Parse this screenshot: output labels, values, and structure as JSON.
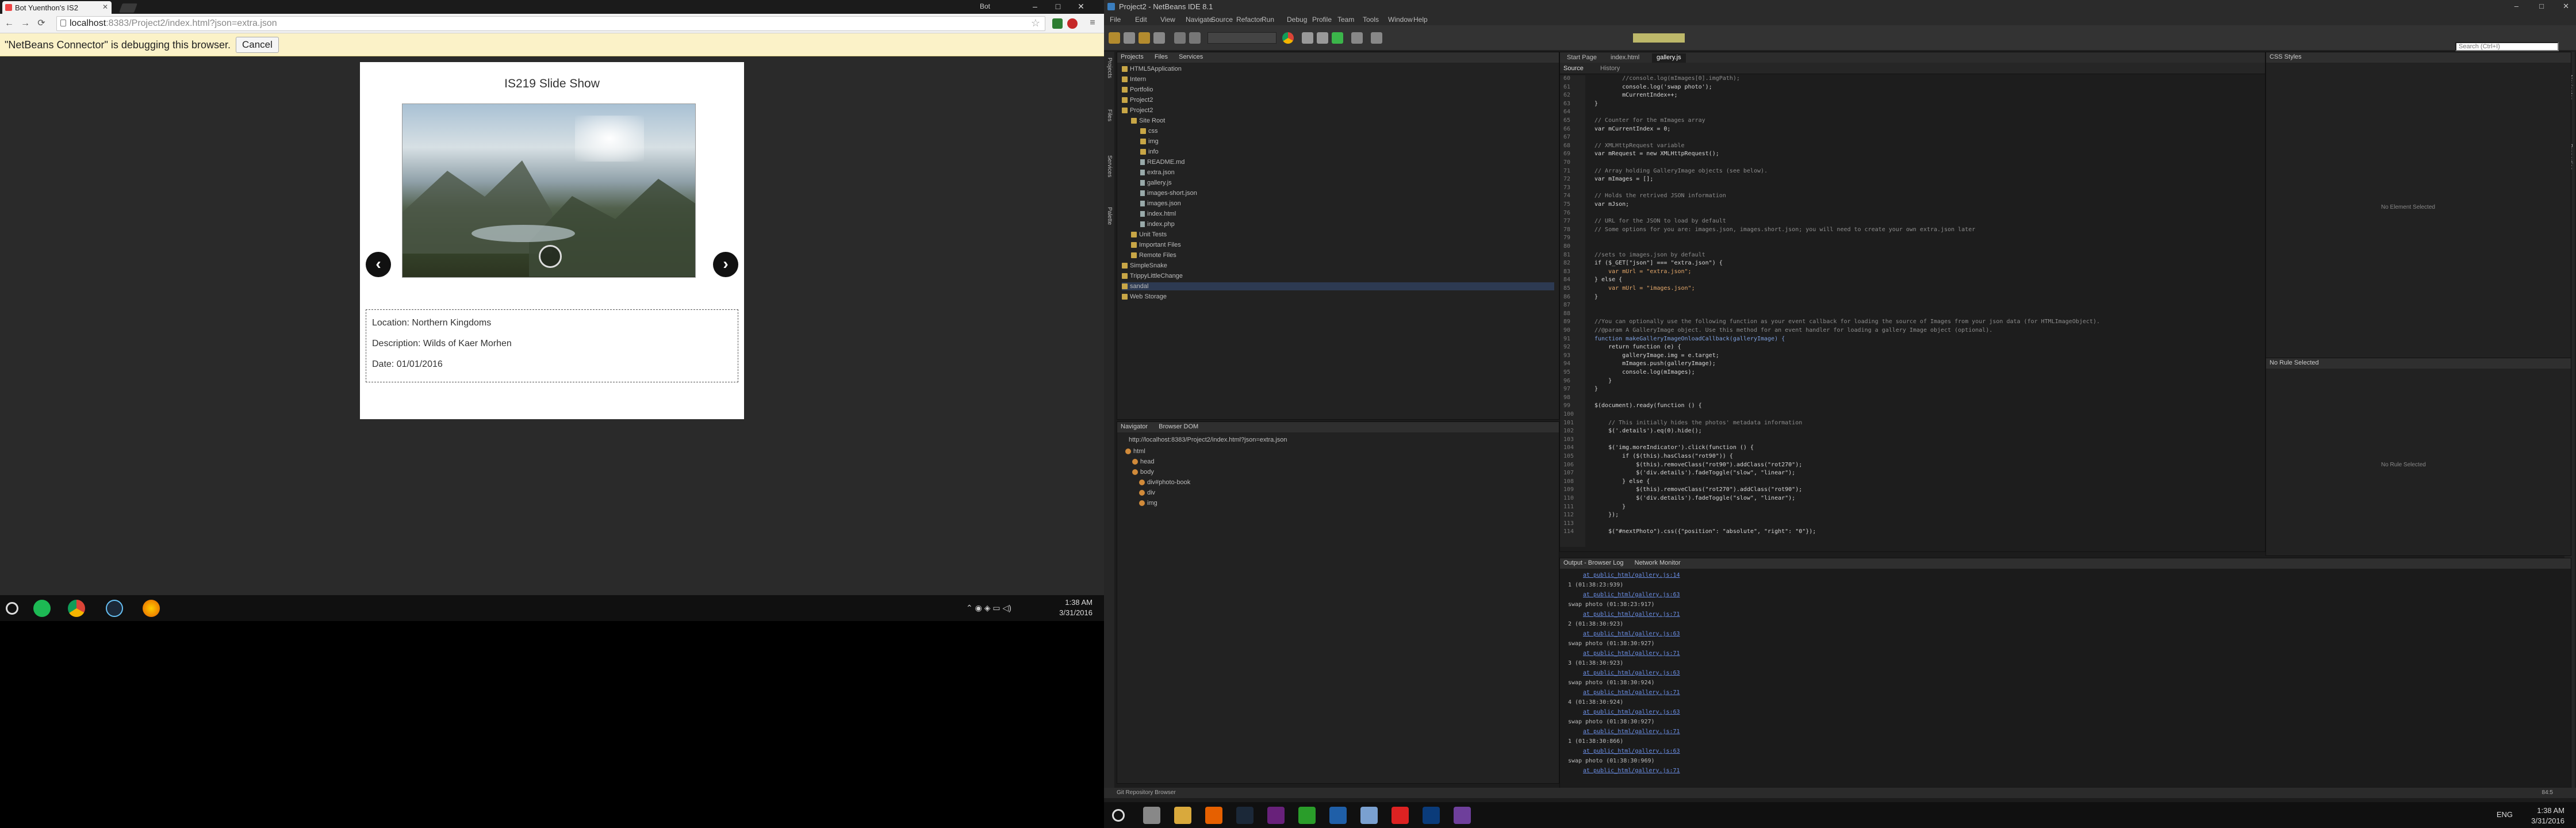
{
  "left_monitor": {
    "chrome": {
      "tabs": [
        {
          "label": "Bot Yuenthon's IS2"
        },
        {
          "label": ""
        }
      ],
      "tab_right_label": "Bot",
      "window_controls": [
        "–",
        "□",
        "✕"
      ],
      "url_host": "localhost",
      "url_path": ":8383/Project2/index.html?json=extra.json",
      "debug_message": "\"NetBeans Connector\" is debugging this browser.",
      "debug_cancel": "Cancel"
    },
    "slideshow": {
      "title": "IS219 Slide Show",
      "prev_glyph": "‹",
      "next_glyph": "›",
      "location": "Location: Northern Kingdoms",
      "description": "Description: Wilds of Kaer Morhen",
      "date": "Date: 01/01/2016"
    },
    "taskbar": {
      "time": "1:38 AM",
      "date": "3/31/2016",
      "icons": [
        "start-icon",
        "spotify-icon",
        "chrome-icon",
        "steam-icon",
        "firefox-icon"
      ]
    }
  },
  "right_monitor": {
    "title": "Project2 - NetBeans IDE 8.1",
    "menu": [
      "File",
      "Edit",
      "View",
      "Navigate",
      "Source",
      "Refactor",
      "Run",
      "Debug",
      "Profile",
      "Team",
      "Tools",
      "Window",
      "Help"
    ],
    "search_placeholder": "Search (Ctrl+I)",
    "left_strip_labels": [
      "Projects",
      "Files",
      "Services",
      "Palette"
    ],
    "right_strip_labels": [
      "Navigator",
      "Properties"
    ],
    "projects_panel": {
      "tabs": [
        "Projects",
        "Files",
        "Services"
      ],
      "rows": [
        {
          "label": "HTML5Application",
          "indent": 0,
          "kind": "folder"
        },
        {
          "label": "Intern",
          "indent": 0,
          "kind": "folder"
        },
        {
          "label": "Portfolio",
          "indent": 0,
          "kind": "folder"
        },
        {
          "label": "Project2",
          "indent": 0,
          "kind": "folder"
        },
        {
          "label": "Project2",
          "indent": 0,
          "kind": "folder"
        },
        {
          "label": "Site Root",
          "indent": 1,
          "kind": "folder"
        },
        {
          "label": "css",
          "indent": 2,
          "kind": "folder"
        },
        {
          "label": "img",
          "indent": 2,
          "kind": "folder"
        },
        {
          "label": "info",
          "indent": 2,
          "kind": "folder"
        },
        {
          "label": "README.md",
          "indent": 2,
          "kind": "file"
        },
        {
          "label": "extra.json",
          "indent": 2,
          "kind": "file"
        },
        {
          "label": "gallery.js",
          "indent": 2,
          "kind": "file"
        },
        {
          "label": "images-short.json",
          "indent": 2,
          "kind": "file"
        },
        {
          "label": "images.json",
          "indent": 2,
          "kind": "file"
        },
        {
          "label": "index.html",
          "indent": 2,
          "kind": "file"
        },
        {
          "label": "index.php",
          "indent": 2,
          "kind": "file"
        },
        {
          "label": "Unit Tests",
          "indent": 1,
          "kind": "folder"
        },
        {
          "label": "Important Files",
          "indent": 1,
          "kind": "folder"
        },
        {
          "label": "Remote Files",
          "indent": 1,
          "kind": "folder"
        },
        {
          "label": "SimpleSnake",
          "indent": 0,
          "kind": "folder"
        },
        {
          "label": "TrippyLittleChange",
          "indent": 0,
          "kind": "folder"
        },
        {
          "label": "sandal",
          "indent": 0,
          "kind": "folder",
          "selected": true
        },
        {
          "label": "Web Storage",
          "indent": 0,
          "kind": "folder"
        }
      ]
    },
    "navigator_panel": {
      "tabs": [
        "Navigator",
        "Browser DOM"
      ],
      "url": "http://localhost:8383/Project2/index.html?json=extra.json",
      "rows": [
        "html",
        "head",
        "body",
        "div#photo-book",
        "div",
        "img"
      ]
    },
    "editor": {
      "tabs": [
        "Start Page",
        "index.html",
        "gallery.js"
      ],
      "sub_tabs": [
        "Source",
        "History"
      ],
      "lines": [
        {
          "n": "",
          "t": "        //console.log(mImages[0].imgPath);",
          "c": "com"
        },
        {
          "n": "",
          "t": "        console.log('swap photo');",
          "c": "code"
        },
        {
          "n": "",
          "t": "        mCurrentIndex++;",
          "c": "code"
        },
        {
          "n": "",
          "t": "}",
          "c": "code"
        },
        {
          "n": "",
          "t": "",
          "c": "code"
        },
        {
          "n": "",
          "t": "// Counter for the mImages array",
          "c": "com"
        },
        {
          "n": "",
          "t": "var mCurrentIndex = 0;",
          "c": "code"
        },
        {
          "n": "",
          "t": "",
          "c": "code"
        },
        {
          "n": "",
          "t": "// XMLHttpRequest variable",
          "c": "com"
        },
        {
          "n": "",
          "t": "var mRequest = new XMLHttpRequest();",
          "c": "code"
        },
        {
          "n": "",
          "t": "",
          "c": "code"
        },
        {
          "n": "",
          "t": "// Array holding GalleryImage objects (see below).",
          "c": "com"
        },
        {
          "n": "",
          "t": "var mImages = [];",
          "c": "code"
        },
        {
          "n": "",
          "t": "",
          "c": "code"
        },
        {
          "n": "",
          "t": "// Holds the retrived JSON information",
          "c": "com"
        },
        {
          "n": "",
          "t": "var mJson;",
          "c": "code"
        },
        {
          "n": "",
          "t": "",
          "c": "code"
        },
        {
          "n": "",
          "t": "// URL for the JSON to load by default",
          "c": "com"
        },
        {
          "n": "",
          "t": "// Some options for you are: images.json, images.short.json; you will need to create your own extra.json later",
          "c": "com"
        },
        {
          "n": "",
          "t": "",
          "c": "code"
        },
        {
          "n": "",
          "t": "",
          "c": "code"
        },
        {
          "n": "",
          "t": "//sets to images.json by default",
          "c": "com"
        },
        {
          "n": "",
          "t": "if ($_GET[\"json\"] === \"extra.json\") {",
          "c": "code"
        },
        {
          "n": "",
          "t": "    var mUrl = \"extra.json\";",
          "c": "str"
        },
        {
          "n": "",
          "t": "} else {",
          "c": "code"
        },
        {
          "n": "",
          "t": "    var mUrl = \"images.json\";",
          "c": "str"
        },
        {
          "n": "",
          "t": "}",
          "c": "code"
        },
        {
          "n": "",
          "t": "",
          "c": "code"
        },
        {
          "n": "",
          "t": "",
          "c": "code"
        },
        {
          "n": "",
          "t": "//You can optionally use the following function as your event callback for loading the source of Images from your json data (for HTMLImageObject).",
          "c": "com"
        },
        {
          "n": "",
          "t": "//@param A GalleryImage object. Use this method for an event handler for loading a gallery Image object (optional).",
          "c": "com"
        },
        {
          "n": "",
          "t": "function makeGalleryImageOnloadCallback(galleryImage) {",
          "c": "key"
        },
        {
          "n": "",
          "t": "    return function (e) {",
          "c": "code"
        },
        {
          "n": "",
          "t": "        galleryImage.img = e.target;",
          "c": "code"
        },
        {
          "n": "",
          "t": "        mImages.push(galleryImage);",
          "c": "code"
        },
        {
          "n": "",
          "t": "        console.log(mImages);",
          "c": "code"
        },
        {
          "n": "",
          "t": "    }",
          "c": "code"
        },
        {
          "n": "",
          "t": "}",
          "c": "code"
        },
        {
          "n": "",
          "t": "",
          "c": "code"
        },
        {
          "n": "",
          "t": "$(document).ready(function () {",
          "c": "code"
        },
        {
          "n": "",
          "t": "",
          "c": "code"
        },
        {
          "n": "",
          "t": "    // This initially hides the photos' metadata information",
          "c": "com"
        },
        {
          "n": "",
          "t": "    $('.details').eq(0).hide();",
          "c": "code"
        },
        {
          "n": "",
          "t": "",
          "c": "code"
        },
        {
          "n": "",
          "t": "    $('img.moreIndicator').click(function () {",
          "c": "code"
        },
        {
          "n": "",
          "t": "        if ($(this).hasClass(\"rot90\")) {",
          "c": "code"
        },
        {
          "n": "",
          "t": "            $(this).removeClass(\"rot90\").addClass(\"rot270\");",
          "c": "code"
        },
        {
          "n": "",
          "t": "            $('div.details').fadeToggle(\"slow\", \"linear\");",
          "c": "code"
        },
        {
          "n": "",
          "t": "        } else {",
          "c": "code"
        },
        {
          "n": "",
          "t": "            $(this).removeClass(\"rot270\").addClass(\"rot90\");",
          "c": "code"
        },
        {
          "n": "",
          "t": "            $('div.details').fadeToggle(\"slow\", \"linear\");",
          "c": "code"
        },
        {
          "n": "",
          "t": "        }",
          "c": "code"
        },
        {
          "n": "",
          "t": "    });",
          "c": "code"
        },
        {
          "n": "",
          "t": "",
          "c": "code"
        },
        {
          "n": "",
          "t": "    $(\"#nextPhoto\").css({\"position\": \"absolute\", \"right\": \"0\"});",
          "c": "code"
        }
      ]
    },
    "output": {
      "tabs": [
        "Output - Browser Log",
        "Network Monitor"
      ],
      "lines": [
        {
          "t": "at public_html/gallery.js:14",
          "link": true
        },
        {
          "t": "1 (01:38:23:939)",
          "link": false
        },
        {
          "t": "at public_html/gallery.js:63",
          "link": true
        },
        {
          "t": "swap photo (01:38:23:917)",
          "link": false
        },
        {
          "t": "at public_html/gallery.js:71",
          "link": true
        },
        {
          "t": "2 (01:38:30:923)",
          "link": false
        },
        {
          "t": "at public_html/gallery.js:63",
          "link": true
        },
        {
          "t": "swap photo (01:38:30:927)",
          "link": false
        },
        {
          "t": "at public_html/gallery.js:71",
          "link": true
        },
        {
          "t": "3 (01:38:30:923)",
          "link": false
        },
        {
          "t": "at public_html/gallery.js:63",
          "link": true
        },
        {
          "t": "swap photo (01:38:30:924)",
          "link": false
        },
        {
          "t": "at public_html/gallery.js:71",
          "link": true
        },
        {
          "t": "4 (01:38:30:924)",
          "link": false
        },
        {
          "t": "at public_html/gallery.js:63",
          "link": true
        },
        {
          "t": "swap photo (01:38:30:927)",
          "link": false
        },
        {
          "t": "at public_html/gallery.js:71",
          "link": true
        },
        {
          "t": "1 (01:38:30:866)",
          "link": false
        },
        {
          "t": "at public_html/gallery.js:63",
          "link": true
        },
        {
          "t": "swap photo (01:38:30:969)",
          "link": false
        },
        {
          "t": "at public_html/gallery.js:71",
          "link": true
        }
      ]
    },
    "css_panel": {
      "title": "CSS Styles",
      "no_element": "No Element Selected",
      "rule_title": "No Rule Selected",
      "no_rule": "No Rule Selected"
    },
    "status": {
      "left": "Git Repository Browser",
      "right": "84:5"
    },
    "taskbar": {
      "time": "1:38 AM",
      "date": "3/31/2016",
      "lang": "ENG",
      "icons": [
        "start-icon",
        "task-view-icon",
        "file-explorer-icon",
        "firefox-icon",
        "steam-icon",
        "visual-studio-icon",
        "shield-icon",
        "virtualbox-icon",
        "cube-icon",
        "acrobat-icon",
        "photoshop-icon",
        "github-icon"
      ]
    }
  }
}
